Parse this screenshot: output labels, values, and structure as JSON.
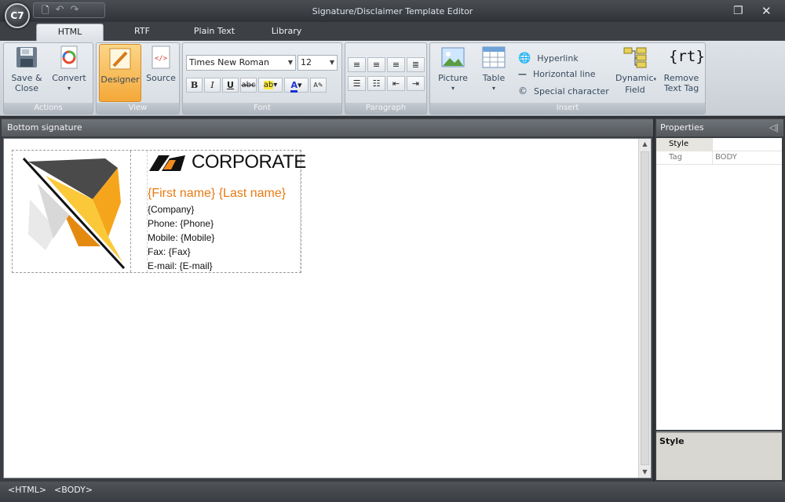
{
  "window": {
    "title": "Signature/Disclaimer Template Editor",
    "logo_text": "C7"
  },
  "tabs": [
    {
      "label": "HTML",
      "active": true
    },
    {
      "label": "RTF",
      "active": false
    },
    {
      "label": "Plain Text",
      "active": false
    },
    {
      "label": "Library",
      "active": false
    }
  ],
  "ribbon": {
    "actions": {
      "label": "Actions",
      "save_close": "Save &\nClose",
      "convert": "Convert"
    },
    "view": {
      "label": "View",
      "designer": "Designer",
      "source": "Source"
    },
    "font": {
      "label": "Font",
      "family": "Times New Roman",
      "size": "12"
    },
    "paragraph": {
      "label": "Paragraph"
    },
    "insert": {
      "label": "Insert",
      "picture": "Picture",
      "table": "Table",
      "hyperlink": "Hyperlink",
      "horizontal_line": "Horizontal line",
      "special_character": "Special character",
      "dynamic_field": "Dynamic\nField",
      "remove_text_tag": "Remove\nText Tag"
    }
  },
  "editor": {
    "panel_title": "Bottom signature",
    "signature": {
      "company_logo_text": "CORPORATE",
      "name": "{First name} {Last name}",
      "company": "{Company}",
      "phone": "Phone: {Phone}",
      "mobile": "Mobile: {Mobile}",
      "fax": "Fax: {Fax}",
      "email": "E-mail: {E-mail}"
    }
  },
  "properties": {
    "title": "Properties",
    "rows": [
      {
        "key": "Style",
        "value": ""
      },
      {
        "key": "Tag",
        "value": "BODY"
      }
    ],
    "description_title": "Style"
  },
  "statusbar": {
    "html_tag": "<HTML>",
    "body_tag": "<BODY>"
  },
  "colors": {
    "accent_orange": "#e87a12",
    "title_bar": "#3d4045",
    "ribbon_bg": "#d6dce2"
  }
}
